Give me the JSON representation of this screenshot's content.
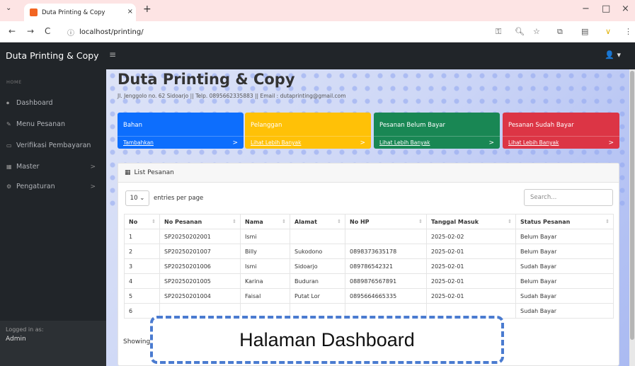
{
  "browser": {
    "tab_title": "Duta Printing & Copy",
    "tab_close": "×",
    "new_tab": "+",
    "url": "localhost/printing/",
    "tab_menu": "⌄",
    "back": "←",
    "forward": "→",
    "reload": "C",
    "minimize": "−",
    "maximize": "□",
    "close": "×"
  },
  "topbar": {
    "brand": "Duta Printing & Copy",
    "menu": "≡",
    "user": "👤 ▾"
  },
  "sidebar": {
    "heading": "HOME",
    "items": [
      {
        "label": "Dashboard",
        "icon": "⏺"
      },
      {
        "label": "Menu Pesanan",
        "icon": "✎"
      },
      {
        "label": "Verifikasi Pembayaran",
        "icon": "▭"
      },
      {
        "label": "Master",
        "icon": "▦",
        "chevron": ">"
      },
      {
        "label": "Pengaturan",
        "icon": "⚙",
        "chevron": ">"
      }
    ],
    "footer_label": "Logged in as:",
    "footer_user": "Admin"
  },
  "main": {
    "title": "Duta Printing & Copy",
    "address": "Jl. Jenggolo no. 62 Sidoarjo || Telp. 0895662335883 || Email : dutaprinting@gmail.com"
  },
  "cards": [
    {
      "title": "Bahan",
      "link": "Tambahkan",
      "arrow": ">",
      "color": "#0d6efd"
    },
    {
      "title": "Pelanggan",
      "link": "Lihat Lebih Banyak",
      "arrow": ">",
      "color": "#ffc107"
    },
    {
      "title": "Pesanan Belum Bayar",
      "link": "Lihat Lebih Banyak",
      "arrow": ">",
      "color": "#198754"
    },
    {
      "title": "Pesanan Sudah Bayar",
      "link": "Lihat Lebih Banyak",
      "arrow": ">",
      "color": "#dc3545"
    }
  ],
  "panel": {
    "header": "List Pesanan",
    "entries_value": "10 ⌄",
    "entries_label": "entries per page",
    "search_placeholder": "Search...",
    "columns": [
      "No",
      "No Pesanan",
      "Nama",
      "Alamat",
      "No HP",
      "Tanggal Masuk",
      "Status Pesanan"
    ],
    "rows": [
      [
        "1",
        "SP20250202001",
        "Ismi",
        "",
        "",
        "2025-02-02",
        "Belum Bayar"
      ],
      [
        "2",
        "SP20250201007",
        "Billy",
        "Sukodono",
        "0898373635178",
        "2025-02-01",
        "Belum Bayar"
      ],
      [
        "3",
        "SP20250201006",
        "Ismi",
        "Sidoarjo",
        "089786542321",
        "2025-02-01",
        "Sudah Bayar"
      ],
      [
        "4",
        "SP20250201005",
        "Karina",
        "Buduran",
        "0889876567891",
        "2025-02-01",
        "Belum Bayar"
      ],
      [
        "5",
        "SP20250201004",
        "Faisal",
        "Putat Lor",
        "0895664665335",
        "2025-02-01",
        "Sudah Bayar"
      ],
      [
        "6",
        "",
        "",
        "",
        "",
        "",
        "Sudah Bayar"
      ]
    ],
    "showing": "Showing"
  },
  "caption": "Halaman Dashboard"
}
